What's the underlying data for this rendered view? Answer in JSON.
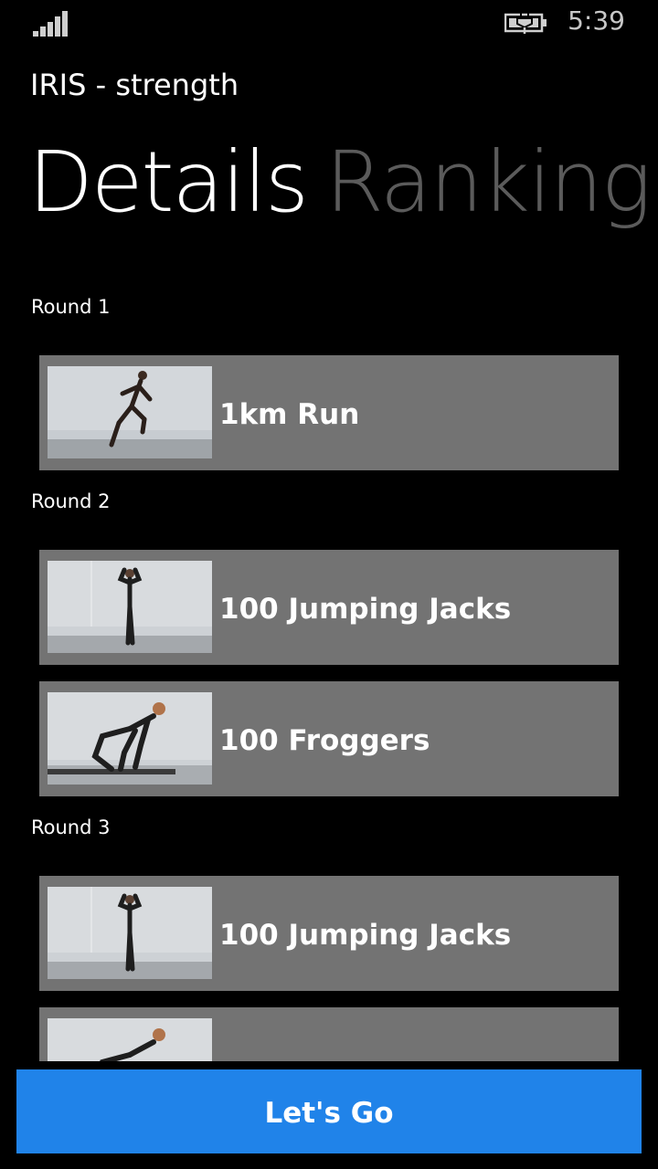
{
  "status_bar": {
    "time": "5:39",
    "signal_icon": "signal-strength-icon",
    "battery_icon": "battery-charging-icon"
  },
  "header": {
    "app_title": "IRIS - strength",
    "pivot_tabs": [
      {
        "label": "Details",
        "active": true
      },
      {
        "label": "Ranking",
        "active": false
      }
    ]
  },
  "rounds": [
    {
      "label": "Round 1",
      "exercises": [
        {
          "label": "1km Run",
          "image": "runner-thumbnail"
        }
      ]
    },
    {
      "label": "Round 2",
      "exercises": [
        {
          "label": "100 Jumping Jacks",
          "image": "jumping-jacks-thumbnail"
        },
        {
          "label": "100 Froggers",
          "image": "froggers-thumbnail"
        }
      ]
    },
    {
      "label": "Round 3",
      "exercises": [
        {
          "label": "100 Jumping Jacks",
          "image": "jumping-jacks-thumbnail"
        },
        {
          "label": "",
          "image": "froggers-thumbnail"
        }
      ]
    }
  ],
  "actions": {
    "start_label": "Let's Go"
  },
  "colors": {
    "background": "#000000",
    "card": "#737373",
    "accent_button": "#2083e9",
    "inactive_pivot": "#5b5b5b"
  }
}
